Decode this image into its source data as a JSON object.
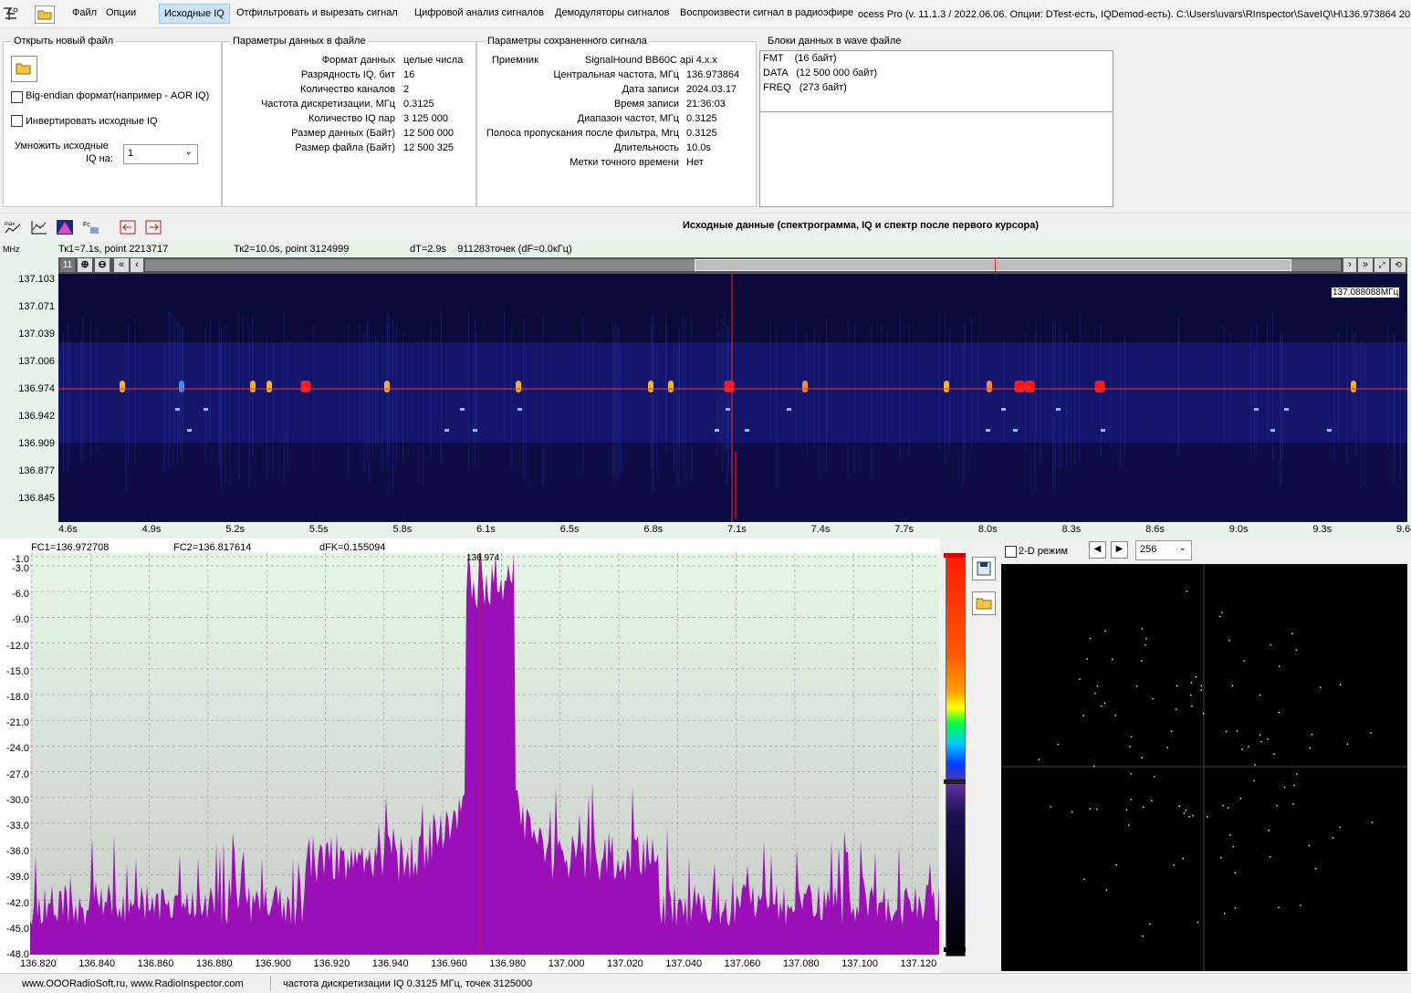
{
  "menubar": {
    "items": [
      "Файл",
      "Опции",
      "Исходные IQ",
      "Отфильтровать и вырезать сигнал",
      "Цифровой анализ сигналов",
      "Демодуляторы сигналов",
      "Воспроизвести сигнал в радиоэфире"
    ],
    "title": "ocess Pro (v. 11.1.3 / 2022.06.06. Опции: DTest-есть, IQDemod-есть). C:\\Users\\uvars\\RInspector\\SaveIQ\\H\\136.973864 202"
  },
  "open_file": {
    "title": "Открыть новый файл",
    "big_endian": "Big-endian формат(например - AOR IQ)",
    "invert": "Инвертировать исходные IQ",
    "multiply_label_1": "Умножить исходные",
    "multiply_label_2": "IQ на:",
    "multiply_value": "1"
  },
  "file_params": {
    "title": "Параметры данных в файле",
    "rows": [
      {
        "label": "Формат данных",
        "value": "целые числа"
      },
      {
        "label": "Разрядность IQ, бит",
        "value": "16"
      },
      {
        "label": "Количество каналов",
        "value": "2"
      },
      {
        "label": "Частота дискретизации, МГц",
        "value": "0.3125"
      },
      {
        "label": "Количество IQ пар",
        "value": "3 125 000"
      },
      {
        "label": "Размер данных (Байт)",
        "value": "12 500 000"
      },
      {
        "label": "Размер файла (Байт)",
        "value": "12 500 325"
      }
    ]
  },
  "saved_params": {
    "title": "Параметры сохраненного сигнала",
    "receiver_label": "Приемник",
    "receiver_value": "SignalHound BB60C api 4.x.x",
    "rows": [
      {
        "label": "Центральная частота, МГц",
        "value": "136.973864"
      },
      {
        "label": "Дата записи",
        "value": "2024.03.17"
      },
      {
        "label": "Время записи",
        "value": "21:36:03"
      },
      {
        "label": "Диапазон частот, МГц",
        "value": "0.3125"
      },
      {
        "label": "Полоса пропускания после фильтра, Мгц",
        "value": "0.3125"
      },
      {
        "label": "Длительность",
        "value": "10.0s"
      },
      {
        "label": "Метки точного времени",
        "value": "Нет"
      }
    ]
  },
  "wave_blocks": {
    "title": "Блоки данных в wave файле",
    "items": [
      "FMT    (16 байт)",
      "DATA   (12 500 000 байт)",
      "FREQ   (273 байт)"
    ]
  },
  "toolbar2": {
    "caption": "Исходные данные (спектрограмма, IQ и спектр после первого курсора)"
  },
  "spectrogram": {
    "unit": "MHz",
    "tk1": "Тк1=7.1s, point 2213717",
    "tk2": "Тк2=10.0s, point 3124999",
    "dt": "dT=2.9s    911283точек (dF=0.0кГц)",
    "scroll_num": "11",
    "freq_marker": "137.088088МГц",
    "y_ticks": [
      "137.103",
      "137.071",
      "137.039",
      "137.006",
      "136.974",
      "136.942",
      "136.909",
      "136.877",
      "136.845"
    ],
    "x_ticks": [
      "4.6s",
      "4.9s",
      "5.2s",
      "5.5s",
      "5.8s",
      "6.1s",
      "6.5s",
      "6.8s",
      "7.1s",
      "7.4s",
      "7.7s",
      "8.0s",
      "8.3s",
      "8.6s",
      "9.0s",
      "9.3s",
      "9.6s"
    ]
  },
  "spectrum": {
    "fc1": "FC1=136.972708",
    "fc2": "FC2=136.817614",
    "dfk": "dFK=0.155094",
    "peak_label": "136.974",
    "y_ticks": [
      "-1.0",
      "-3.0",
      "-6.0",
      "-9.0",
      "-12.0",
      "-15.0",
      "-18.0",
      "-21.0",
      "-24.0",
      "-27.0",
      "-30.0",
      "-33.0",
      "-36.0",
      "-39.0",
      "-42.0",
      "-45.0",
      "-48.0"
    ],
    "x_ticks": [
      "136.820",
      "136.840",
      "136.860",
      "136.880",
      "136.900",
      "136.920",
      "136.940",
      "136.960",
      "136.980",
      "137.000",
      "137.020",
      "137.040",
      "137.060",
      "137.080",
      "137.100",
      "137.120"
    ],
    "fill_color": "#9a0fb8"
  },
  "scope": {
    "mode_label": "2-D режим",
    "points_value": "256"
  },
  "status": {
    "site": "www.OOORadioSoft.ru, www.RadioInspector.com",
    "info": "частота дискретизации IQ 0.3125 МГц, точек 3125000"
  }
}
